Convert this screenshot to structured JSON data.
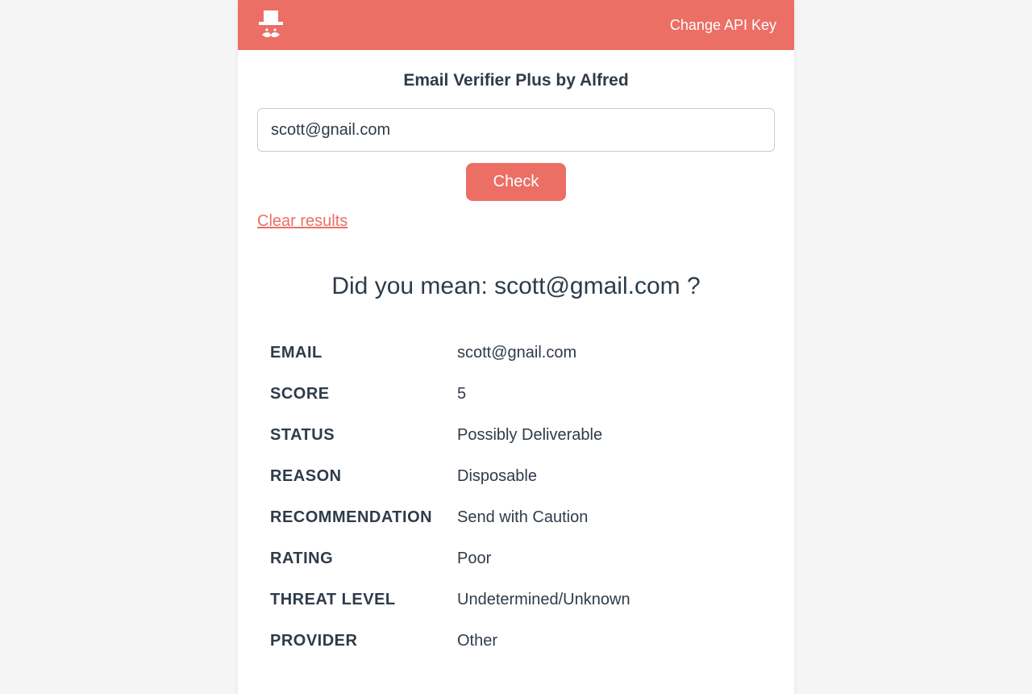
{
  "brand": {
    "accent": "#eb6f65"
  },
  "header": {
    "api_link": "Change API Key"
  },
  "main": {
    "title": "Email Verifier Plus by Alfred",
    "email_input_value": "scott@gnail.com",
    "check_label": "Check",
    "clear_label": "Clear results",
    "suggestion_prefix": "Did you mean: ",
    "suggestion_email": "scott@gmail.com",
    "suggestion_suffix": " ?",
    "suggestion_full": "Did you mean: scott@gmail.com ?"
  },
  "result": {
    "rows": [
      {
        "label": "EMAIL",
        "value": "scott@gnail.com"
      },
      {
        "label": "SCORE",
        "value": "5"
      },
      {
        "label": "STATUS",
        "value": "Possibly Deliverable"
      },
      {
        "label": "REASON",
        "value": "Disposable"
      },
      {
        "label": "RECOMMENDATION",
        "value": "Send with Caution"
      },
      {
        "label": "RATING",
        "value": "Poor"
      },
      {
        "label": "THREAT LEVEL",
        "value": "Undetermined/Unknown"
      },
      {
        "label": "PROVIDER",
        "value": "Other"
      }
    ]
  }
}
